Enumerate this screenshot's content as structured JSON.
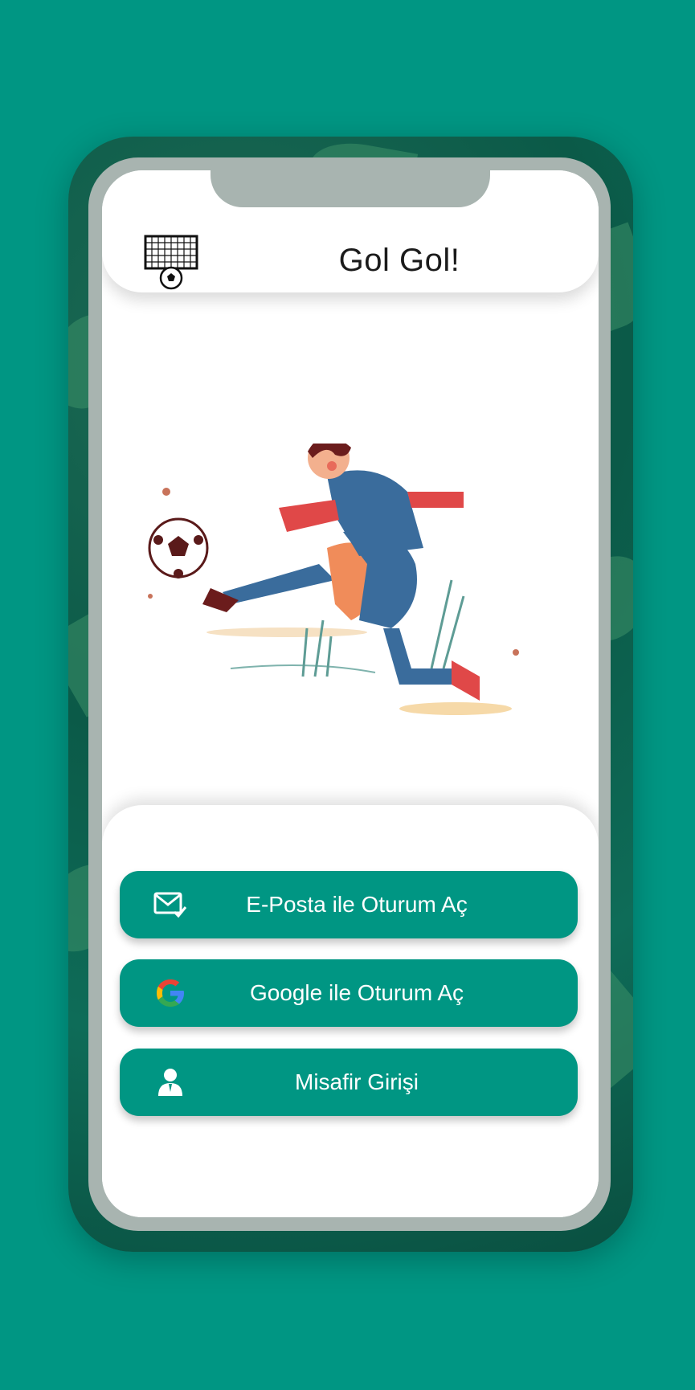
{
  "header": {
    "title": "Gol Gol!",
    "logo_icon": "soccer-goal-icon"
  },
  "buttons": [
    {
      "label": "E-Posta ile Oturum Aç",
      "icon": "mail-check-icon"
    },
    {
      "label": "Google ile Oturum Aç",
      "icon": "google-icon"
    },
    {
      "label": "Misafir Girişi",
      "icon": "guest-user-icon"
    }
  ],
  "colors": {
    "background": "#009683",
    "button": "#009683",
    "screen": "#ffffff"
  }
}
